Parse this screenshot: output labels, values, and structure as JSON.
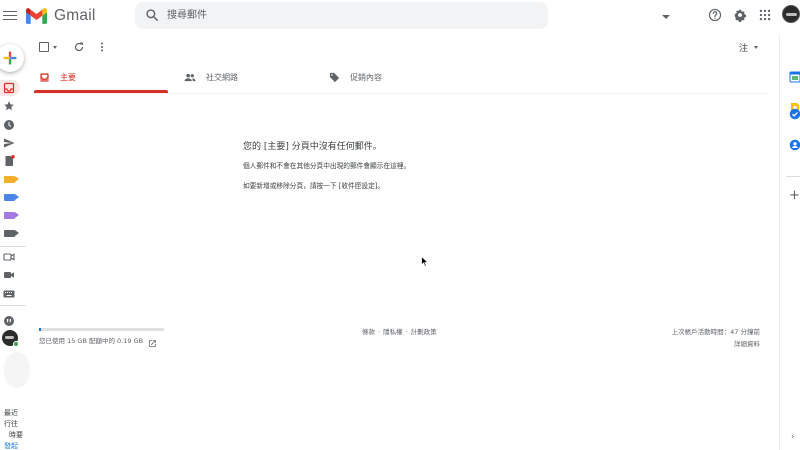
{
  "app": {
    "name": "Gmail"
  },
  "search": {
    "placeholder": "搜尋郵件"
  },
  "toolbar": {
    "input_tools_label": "注"
  },
  "tabs": [
    {
      "label": "主要",
      "icon": "inbox-icon",
      "active": true
    },
    {
      "label": "社交網路",
      "icon": "people-icon",
      "active": false
    },
    {
      "label": "促銷內容",
      "icon": "tag-icon",
      "active": false
    }
  ],
  "empty_state": {
    "title": "您的 [主要] 分頁中沒有任何郵件。",
    "subtitle": "個人郵件和不會在其他分頁中出現的郵件會顯示在這裡。",
    "hint": "如要新增或移除分頁，請按一下 [收件匣設定]。"
  },
  "footer": {
    "storage_text": "您已使用 15 GB 配額中的 0.19 GB",
    "storage_fraction": 0.013,
    "links": [
      "條款",
      "隱私權",
      "計劃政策"
    ],
    "last_activity": "上次帳戶活動時間：47 分鐘前",
    "details_label": "詳細資料"
  },
  "rail": {
    "label_colors": [
      "#f6ae2d",
      "#4a86e8",
      "#a479e2",
      "#a479e2",
      "#5f6368"
    ],
    "text_lines": [
      "最近",
      "行往",
      "時要"
    ],
    "link_label": "發起"
  },
  "colors": {
    "accent": "#d93025",
    "brand_blue": "#1a73e8"
  }
}
